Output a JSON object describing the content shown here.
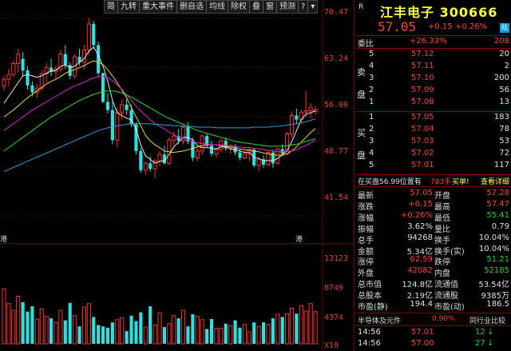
{
  "toolbar": {
    "items": [
      "简",
      "九转",
      "重大事件",
      "删自选",
      "均线",
      "除权",
      "叠",
      "窗",
      "预测"
    ],
    "icons": [
      "question-icon",
      "chevron-down-icon"
    ]
  },
  "chart": {
    "price_ticks": [
      "70.47",
      "63.24",
      "56.00",
      "48.77",
      "41.54"
    ],
    "volume_ticks": [
      "13123",
      "8749",
      "4374",
      "X10"
    ],
    "event_markers": [
      "港",
      "港"
    ]
  },
  "chart_data": {
    "type": "candlestick",
    "ylim": [
      38,
      71
    ],
    "candles": [
      [
        60.5,
        62.0,
        59.8,
        61.5
      ],
      [
        61.5,
        63.0,
        60.5,
        62.2
      ],
      [
        62.2,
        64.2,
        61.8,
        63.8
      ],
      [
        63.8,
        66.0,
        62.5,
        65.2
      ],
      [
        64.5,
        65.5,
        62.0,
        62.8
      ],
      [
        62.8,
        63.4,
        60.0,
        60.6
      ],
      [
        60.6,
        61.2,
        59.0,
        59.6
      ],
      [
        59.6,
        60.8,
        58.8,
        60.2
      ],
      [
        60.2,
        62.8,
        59.8,
        62.3
      ],
      [
        62.3,
        63.9,
        61.0,
        63.2
      ],
      [
        63.2,
        64.5,
        62.0,
        62.6
      ],
      [
        62.6,
        63.5,
        61.5,
        63.0
      ],
      [
        63.0,
        65.8,
        62.5,
        65.2
      ],
      [
        65.2,
        66.5,
        63.0,
        63.6
      ],
      [
        63.6,
        64.0,
        61.5,
        62.0
      ],
      [
        62.0,
        65.2,
        61.6,
        64.8
      ],
      [
        64.8,
        66.0,
        63.5,
        64.0
      ],
      [
        64.0,
        66.5,
        63.0,
        65.8
      ],
      [
        65.8,
        70.5,
        65.0,
        69.6
      ],
      [
        69.6,
        70.0,
        66.0,
        66.5
      ],
      [
        66.5,
        67.0,
        61.8,
        62.4
      ],
      [
        62.4,
        62.5,
        58.0,
        58.2
      ],
      [
        58.2,
        59.5,
        56.5,
        57.0
      ],
      [
        57.0,
        58.2,
        52.0,
        52.6
      ],
      [
        52.6,
        57.4,
        51.5,
        56.6
      ],
      [
        56.6,
        58.5,
        55.5,
        57.8
      ],
      [
        57.8,
        58.6,
        56.3,
        57.0
      ],
      [
        57.0,
        57.8,
        54.5,
        54.9
      ],
      [
        54.9,
        55.2,
        50.5,
        51.0
      ],
      [
        51.0,
        51.5,
        47.8,
        48.2
      ],
      [
        48.2,
        49.5,
        47.5,
        49.2
      ],
      [
        49.2,
        50.2,
        48.0,
        48.4
      ],
      [
        48.4,
        49.8,
        47.0,
        49.5
      ],
      [
        49.5,
        51.0,
        48.8,
        50.5
      ],
      [
        50.5,
        51.8,
        49.0,
        49.2
      ],
      [
        49.2,
        53.0,
        49.0,
        52.6
      ],
      [
        52.6,
        53.8,
        51.8,
        53.2
      ],
      [
        53.2,
        54.2,
        52.0,
        52.5
      ],
      [
        52.5,
        55.0,
        52.0,
        54.5
      ],
      [
        54.5,
        55.2,
        52.0,
        52.4
      ],
      [
        52.4,
        53.0,
        49.5,
        50.0
      ],
      [
        50.0,
        51.5,
        49.5,
        51.0
      ],
      [
        51.0,
        53.5,
        50.5,
        53.2
      ],
      [
        53.2,
        53.6,
        51.5,
        51.8
      ],
      [
        51.8,
        52.5,
        50.2,
        50.6
      ],
      [
        50.6,
        51.5,
        50.0,
        51.2
      ],
      [
        51.2,
        52.8,
        50.8,
        52.5
      ],
      [
        52.5,
        53.0,
        51.0,
        51.4
      ],
      [
        51.4,
        52.0,
        50.6,
        51.6
      ],
      [
        51.6,
        52.0,
        50.4,
        50.8
      ],
      [
        50.8,
        51.2,
        49.6,
        50.0
      ],
      [
        50.0,
        51.0,
        49.8,
        50.6
      ],
      [
        50.6,
        51.5,
        49.5,
        51.2
      ],
      [
        51.2,
        51.4,
        48.6,
        48.9
      ],
      [
        48.9,
        50.2,
        48.0,
        49.8
      ],
      [
        49.8,
        50.4,
        48.5,
        49.0
      ],
      [
        49.0,
        51.0,
        48.8,
        50.8
      ],
      [
        50.8,
        51.2,
        48.5,
        49.2
      ],
      [
        49.2,
        51.5,
        49.0,
        51.3
      ],
      [
        51.3,
        52.0,
        50.2,
        50.6
      ],
      [
        50.6,
        53.8,
        50.4,
        53.5
      ],
      [
        53.5,
        56.8,
        53.0,
        56.2
      ],
      [
        56.2,
        57.2,
        55.0,
        55.6
      ],
      [
        55.6,
        57.0,
        55.2,
        56.7
      ],
      [
        56.7,
        59.8,
        56.0,
        56.9
      ],
      [
        56.9,
        58.0,
        55.8,
        57.4
      ],
      [
        56.8,
        57.6,
        56.4,
        57.05
      ]
    ],
    "volume_ylim": [
      0,
      13123
    ],
    "volume": [
      8.2,
      6.0,
      5.0,
      7.1,
      6.2,
      4.8,
      5.6,
      3.7,
      5.2,
      4.1,
      3.8,
      3.2,
      5.0,
      3.5,
      6.1,
      4.2,
      2.6,
      5.5,
      6.0,
      4.0,
      2.8,
      2.6,
      2.4,
      3.2,
      3.6,
      3.9,
      1.9,
      4.2,
      3.4,
      4.7,
      2.5,
      5.6,
      2.8,
      4.6,
      2.5,
      3.0,
      4.2,
      3.8,
      5.0,
      2.6,
      4.4,
      4.1,
      3.6,
      2.2,
      3.7,
      2.3,
      2.3,
      3.0,
      2.7,
      3.5,
      2.4,
      2.9,
      1.8,
      3.2,
      2.6,
      3.2,
      2.9,
      3.8,
      4.4,
      4.0,
      4.5,
      5.3,
      4.5,
      5.7,
      4.9,
      6.0,
      4.8
    ],
    "ma_series": [
      {
        "color": "#e8e8e8",
        "values": [
          58,
          59,
          60,
          61,
          62,
          62.2,
          62.0,
          61.8,
          62.0,
          62.4,
          62.7,
          62.8,
          63.4,
          63.6,
          63.2,
          63.4,
          64.0,
          64.5,
          65.6,
          66.2,
          65.0,
          63.4,
          61.2,
          58.4,
          56.6,
          56.2,
          55.8,
          55.6,
          54.2,
          51.9,
          50.3,
          49.8,
          49.2,
          49.5,
          49.6,
          50.5,
          51.6,
          52.3,
          53.0,
          53.0,
          52.6,
          51.8,
          51.5,
          51.5,
          51.4,
          51.3,
          51.6,
          51.6,
          51.3,
          51.2,
          51.0,
          50.8,
          50.8,
          50.1,
          49.9,
          49.6,
          49.6,
          49.6,
          49.9,
          50.5,
          51.1,
          52.4,
          54.0,
          55.6,
          56.4,
          56.6,
          56.9
        ]
      },
      {
        "color": "#e8e020",
        "values": [
          56,
          56.5,
          57,
          57.6,
          58.2,
          58.8,
          59.3,
          59.8,
          60.3,
          60.8,
          61.2,
          61.5,
          61.9,
          62.4,
          62.7,
          62.9,
          63.2,
          63.5,
          63.9,
          64.2,
          64.0,
          63.6,
          62.9,
          62.0,
          61.0,
          59.9,
          58.8,
          57.4,
          56.0,
          54.7,
          53.3,
          52.5,
          51.9,
          51.5,
          51.0,
          50.9,
          50.8,
          50.9,
          51.0,
          51.2,
          51.4,
          51.6,
          51.8,
          51.9,
          52.0,
          51.9,
          51.8,
          51.7,
          51.6,
          51.5,
          51.3,
          51.2,
          51.1,
          51.0,
          50.9,
          50.7,
          50.6,
          50.4,
          50.4,
          50.4,
          50.6,
          51.0,
          51.6,
          52.3,
          53.0,
          53.7,
          54.3
        ]
      },
      {
        "color": "#e020e0",
        "values": [
          54,
          54.5,
          55,
          55.5,
          56,
          56.5,
          57,
          57.4,
          57.8,
          58.2,
          58.6,
          59.0,
          59.4,
          59.8,
          60.2,
          60.5,
          60.8,
          61.1,
          61.4,
          61.7,
          61.9,
          61.9,
          61.7,
          61.3,
          60.7,
          60.0,
          59.2,
          58.4,
          57.6,
          56.9,
          56.2,
          55.6,
          55.0,
          54.6,
          54.2,
          53.8,
          53.4,
          53.1,
          52.8,
          52.6,
          52.4,
          52.2,
          52.1,
          52.0,
          52.0,
          51.9,
          51.9,
          51.8,
          51.8,
          51.7,
          51.6,
          51.5,
          51.5,
          51.4,
          51.3,
          51.2,
          51.1,
          51.0,
          50.9,
          50.9,
          50.9,
          51.0,
          51.2,
          51.5,
          51.8,
          52.2,
          52.6
        ]
      },
      {
        "color": "#20e020",
        "values": [
          51,
          51.5,
          52,
          52.5,
          53,
          53.5,
          54,
          54.5,
          55,
          55.5,
          56,
          56.4,
          56.8,
          57.2,
          57.6,
          58.0,
          58.4,
          58.7,
          59.0,
          59.3,
          59.5,
          59.7,
          59.8,
          59.8,
          59.7,
          59.5,
          59.2,
          58.9,
          58.5,
          58.1,
          57.7,
          57.3,
          56.9,
          56.5,
          56.1,
          55.8,
          55.5,
          55.2,
          54.9,
          54.6,
          54.3,
          54.0,
          53.8,
          53.6,
          53.4,
          53.2,
          53.0,
          52.8,
          52.6,
          52.4,
          52.3,
          52.2,
          52.1,
          52.0,
          51.9,
          51.8,
          51.7,
          51.7,
          51.7,
          51.7,
          51.8,
          51.9,
          52.0,
          52.2,
          52.4,
          52.6,
          52.8
        ]
      },
      {
        "color": "#20a0e0",
        "values": [
          48,
          48.3,
          48.6,
          48.9,
          49.2,
          49.5,
          49.8,
          50.1,
          50.4,
          50.7,
          51.0,
          51.3,
          51.6,
          51.9,
          52.2,
          52.5,
          52.8,
          53.1,
          53.4,
          53.7,
          54.0,
          54.2,
          54.4,
          54.6,
          54.7,
          54.8,
          54.9,
          55.0,
          55.0,
          55.0,
          55.0,
          55.0,
          54.9,
          54.9,
          54.8,
          54.8,
          54.7,
          54.7,
          54.6,
          54.6,
          54.6,
          54.5,
          54.5,
          54.5,
          54.5,
          54.4,
          54.4,
          54.4,
          54.4,
          54.4,
          54.4,
          54.4,
          54.4,
          54.5,
          54.5,
          54.5,
          54.5,
          54.6,
          54.6,
          54.7,
          54.8,
          54.9,
          55.0,
          55.1,
          55.3,
          55.5,
          55.7
        ]
      }
    ]
  },
  "stock": {
    "market_tag": "R",
    "name": "江丰电子",
    "code": "300666",
    "price": "57.05",
    "change": "+0.15",
    "change_pct": "+0.26%",
    "board_tag": "陆"
  },
  "commission": {
    "label": "委比",
    "ratio": "+26.33%",
    "diff": "208"
  },
  "sell_orders": {
    "side_label": [
      "卖",
      "盘"
    ],
    "levels": [
      {
        "level": "5",
        "price": "57.12",
        "vol": "20"
      },
      {
        "level": "4",
        "price": "57.11",
        "vol": "2"
      },
      {
        "level": "3",
        "price": "57.10",
        "vol": "200"
      },
      {
        "level": "2",
        "price": "57.09",
        "vol": "56"
      },
      {
        "level": "1",
        "price": "57.08",
        "vol": "13"
      }
    ]
  },
  "buy_orders": {
    "side_label": [
      "买",
      "盘"
    ],
    "levels": [
      {
        "level": "1",
        "price": "57.05",
        "vol": "183"
      },
      {
        "level": "2",
        "price": "57.04",
        "vol": "78"
      },
      {
        "level": "3",
        "price": "57.03",
        "vol": "53"
      },
      {
        "level": "4",
        "price": "57.02",
        "vol": "72"
      },
      {
        "level": "5",
        "price": "57.01",
        "vol": "117"
      }
    ]
  },
  "inner_bar": {
    "text": "在买盘56.99位置有",
    "vol": "783手",
    "buy": "买单!",
    "detail": "查看详细"
  },
  "stats": [
    {
      "l1": "最新",
      "v1": "57.05",
      "c1": "red",
      "l2": "开盘",
      "v2": "57.28",
      "c2": "red"
    },
    {
      "l1": "涨跌",
      "v1": "+0.15",
      "c1": "red",
      "l2": "最高",
      "v2": "57.47",
      "c2": "red"
    },
    {
      "l1": "涨幅",
      "v1": "+0.26%",
      "c1": "red",
      "l2": "最低",
      "v2": "55.41",
      "c2": "green"
    },
    {
      "l1": "振幅",
      "v1": "3.62%",
      "c1": "white",
      "l2": "量比",
      "v2": "0.79",
      "c2": "white"
    },
    {
      "l1": "总手",
      "v1": "94268",
      "c1": "white",
      "l2": "换手",
      "v2": "10.04%",
      "c2": "white"
    },
    {
      "l1": "金额",
      "v1": "5.34亿",
      "c1": "white",
      "l2": "换手(实)",
      "v2": "10.04%",
      "c2": "white"
    },
    {
      "l1": "涨停",
      "v1": "62.59",
      "c1": "red",
      "l2": "跌停",
      "v2": "51.21",
      "c2": "green"
    },
    {
      "l1": "外盘",
      "v1": "42082",
      "c1": "red",
      "l2": "内盘",
      "v2": "52185",
      "c2": "green"
    },
    {
      "l1": "总市值",
      "v1": "124.8亿",
      "c1": "white",
      "l2": "流通值",
      "v2": "53.54亿",
      "c2": "white"
    },
    {
      "l1": "总股本",
      "v1": "2.19亿",
      "c1": "white",
      "l2": "流通股",
      "v2": "9385万",
      "c2": "white"
    },
    {
      "l1": "市盈(静)",
      "v1": "194.4",
      "c1": "white",
      "l2": "市盈(动)",
      "v2": "186.5",
      "c2": "white"
    }
  ],
  "tabs": {
    "left": "半导体及元件",
    "left_val": "0.90%",
    "right": "同行业比较"
  },
  "ticks": [
    {
      "time": "14:56",
      "price": "57.01",
      "vol": "12",
      "dir": "down"
    },
    {
      "time": "14:56",
      "price": "57.00",
      "vol": "27",
      "dir": "down"
    }
  ]
}
